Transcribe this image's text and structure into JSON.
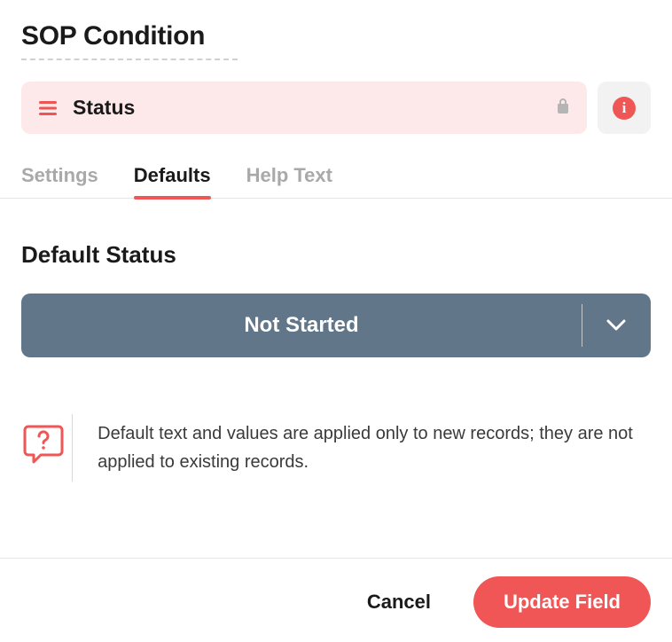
{
  "page_title": "SOP Condition",
  "field": {
    "name": "Status",
    "locked": true
  },
  "tabs": [
    {
      "key": "settings",
      "label": "Settings",
      "active": false
    },
    {
      "key": "defaults",
      "label": "Defaults",
      "active": true
    },
    {
      "key": "help",
      "label": "Help Text",
      "active": false
    }
  ],
  "section_title": "Default Status",
  "dropdown": {
    "selected": "Not Started"
  },
  "hint": "Default text and values are applied only to new records; they are not applied to existing records.",
  "buttons": {
    "cancel": "Cancel",
    "update": "Update Field"
  },
  "info_glyph": "i"
}
